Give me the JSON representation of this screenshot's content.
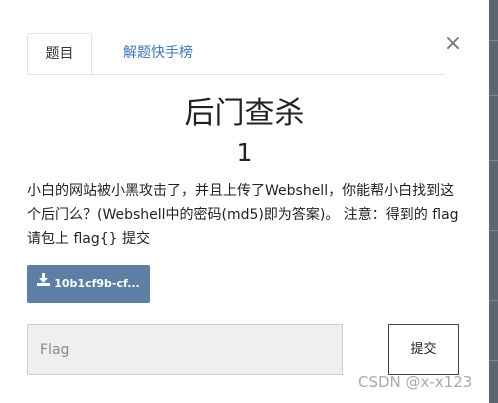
{
  "tabs": {
    "challenge": "题目",
    "solves": "解题快手榜"
  },
  "close_symbol": "×",
  "challenge": {
    "name": "后门查杀",
    "points": "1",
    "description": "小白的网站被小黑攻击了，并且上传了Webshell，你能帮小白找到这个后门么？(Webshell中的密码(md5)即为答案)。 注意：得到的 flag 请包上 flag{} 提交",
    "download_label": "10b1cf9b-cf..."
  },
  "flag_form": {
    "placeholder": "Flag",
    "submit_label": "提交"
  },
  "watermark": "CSDN @x-x123",
  "icons": {
    "download": "download-icon",
    "close": "close-icon"
  },
  "colors": {
    "tab_link": "#3d79b8",
    "download_button": "#5d7fa3",
    "input_bg": "#efefef"
  }
}
